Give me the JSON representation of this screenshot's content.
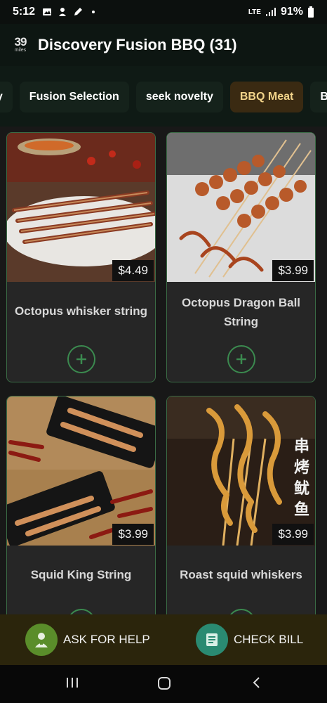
{
  "status_bar": {
    "time": "5:12",
    "network": "LTE",
    "battery": "91%"
  },
  "header": {
    "logo_text": "39",
    "logo_sub": "miles",
    "title": "Discovery Fusion BBQ (31)"
  },
  "tabs": [
    {
      "label": "cy",
      "active": false
    },
    {
      "label": "Fusion Selection",
      "active": false
    },
    {
      "label": "seek novelty",
      "active": false
    },
    {
      "label": "BBQ Meat",
      "active": true
    },
    {
      "label": "B",
      "active": false
    }
  ],
  "items": [
    {
      "name": "Octopus whisker string",
      "price": "$4.49"
    },
    {
      "name": "Octopus Dragon Ball String",
      "price": "$3.99"
    },
    {
      "name": "Squid King String",
      "price": "$3.99"
    },
    {
      "name": "Roast squid whiskers",
      "price": "$3.99",
      "image_text": "串烤鱿鱼"
    }
  ],
  "actions": {
    "help_label": "ASK FOR HELP",
    "bill_label": "CHECK BILL"
  },
  "colors": {
    "accent_green": "#3b8a4f",
    "active_tab_bg": "#3a2a12",
    "bottom_bar_bg": "#2b250c"
  }
}
